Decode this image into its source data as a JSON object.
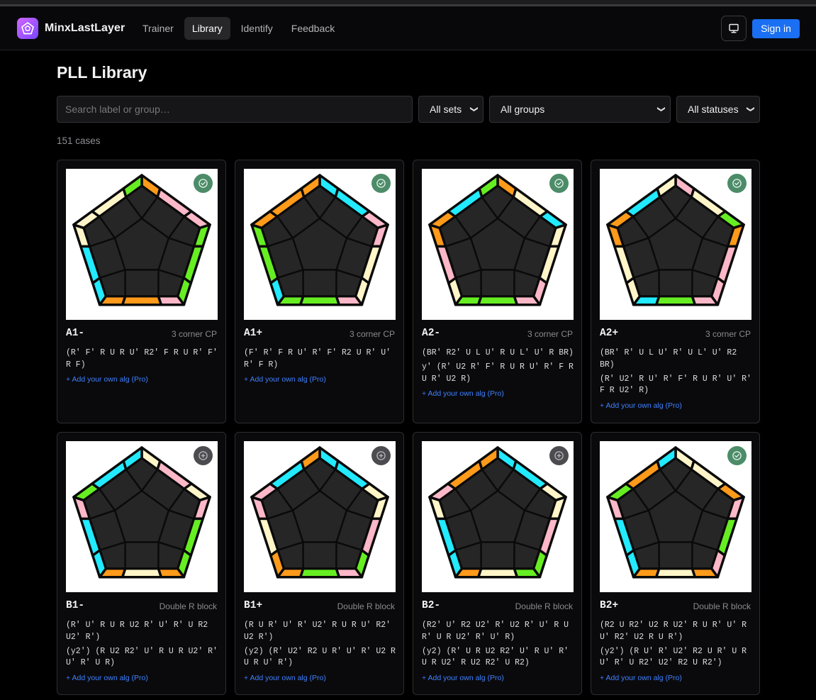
{
  "app": {
    "name": "MinxLastLayer",
    "signin_label": "Sign in"
  },
  "nav": [
    {
      "label": "Trainer",
      "active": false
    },
    {
      "label": "Library",
      "active": true
    },
    {
      "label": "Identify",
      "active": false
    },
    {
      "label": "Feedback",
      "active": false
    }
  ],
  "page": {
    "title": "PLL Library",
    "count_text": "151 cases"
  },
  "filters": {
    "search_placeholder": "Search label or group…",
    "sets": "All sets",
    "groups": "All groups",
    "statuses": "All statuses"
  },
  "add_alg_label": "+ Add your own alg (Pro)",
  "colors": {
    "orange": "#ff9a1a",
    "green": "#66ee22",
    "cream": "#fff5c8",
    "pink": "#fcb8c8",
    "cyan": "#22eaff",
    "face": "#262626",
    "brand": "#1a6ff2"
  },
  "cards": [
    {
      "label": "A1-",
      "group": "3 corner CP",
      "status": "learned",
      "algs": [
        "(R' F' R U R U' R2' F R U R' F' R F)"
      ],
      "edge_colors": [
        "orange",
        "pink",
        "pink",
        "green",
        "green",
        "green",
        "pink",
        "orange",
        "orange",
        "cyan",
        "cyan",
        "cream",
        "cream",
        "cream",
        "green"
      ]
    },
    {
      "label": "A1+",
      "group": "3 corner CP",
      "status": "learned",
      "algs": [
        "(F' R' F R U' R' F' R2 U R' U' R' F R)"
      ],
      "edge_colors": [
        "cyan",
        "cyan",
        "pink",
        "pink",
        "cream",
        "cream",
        "pink",
        "green",
        "green",
        "cyan",
        "green",
        "green",
        "orange",
        "orange",
        "orange"
      ]
    },
    {
      "label": "A2-",
      "group": "3 corner CP",
      "status": "learned",
      "algs": [
        "(BR' R2' U L U' R U L' U' R BR)",
        "y' (R' U2 R' F' R U R U' R' F R U R' U2 R)"
      ],
      "edge_colors": [
        "orange",
        "cream",
        "cyan",
        "cream",
        "cream",
        "pink",
        "pink",
        "green",
        "green",
        "cream",
        "pink",
        "orange",
        "orange",
        "cyan",
        "green"
      ]
    },
    {
      "label": "A2+",
      "group": "3 corner CP",
      "status": "learned",
      "algs": [
        "(BR' R' U L U' R' U L' U' R2 BR)",
        "(R' U2' R U' R' F' R U R' U' R' F R U2' R)"
      ],
      "edge_colors": [
        "pink",
        "cream",
        "green",
        "orange",
        "pink",
        "pink",
        "pink",
        "green",
        "cyan",
        "cream",
        "cream",
        "orange",
        "orange",
        "cyan",
        "cream"
      ]
    },
    {
      "label": "B1-",
      "group": "Double R block",
      "status": "unlearned",
      "algs": [
        "(R' U' R U R U2 R' U' R' U R2 U2' R')",
        "(y2') (R U2 R2' U' R U R U2' R' U' R' U R)"
      ],
      "edge_colors": [
        "cream",
        "pink",
        "cream",
        "pink",
        "green",
        "green",
        "orange",
        "cream",
        "orange",
        "cyan",
        "cyan",
        "pink",
        "green",
        "cyan",
        "cyan"
      ]
    },
    {
      "label": "B1+",
      "group": "Double R block",
      "status": "unlearned",
      "algs": [
        "(R U R' U' R' U2' R U R U' R2' U2 R')",
        "(y2) (R' U2' R2 U R' U' R' U2 R U R U' R')"
      ],
      "edge_colors": [
        "cyan",
        "cyan",
        "cream",
        "cream",
        "pink",
        "green",
        "pink",
        "green",
        "orange",
        "orange",
        "cream",
        "pink",
        "pink",
        "cyan",
        "orange"
      ]
    },
    {
      "label": "B2-",
      "group": "Double R block",
      "status": "unlearned",
      "algs": [
        "(R2' U' R2 U2' R' U2 R' U' R U R' U R U2' R' U' R)",
        "(y2) (R' U R U2 R2' U' R U' R' U R U2' R U2 R2' U R2)"
      ],
      "edge_colors": [
        "cyan",
        "cyan",
        "cream",
        "cream",
        "pink",
        "green",
        "green",
        "cream",
        "orange",
        "cyan",
        "cyan",
        "cream",
        "pink",
        "orange",
        "orange"
      ]
    },
    {
      "label": "B2+",
      "group": "Double R block",
      "status": "learned",
      "algs": [
        "(R2 U R2' U2 R U2' R U R' U' R U' R2' U2 R U R')",
        "(y2') (R U' R' U2' R2 U R' U R U' R' U R2' U2' R2 U R2')"
      ],
      "edge_colors": [
        "cream",
        "cream",
        "orange",
        "pink",
        "green",
        "pink",
        "orange",
        "cream",
        "orange",
        "cyan",
        "cyan",
        "pink",
        "green",
        "orange",
        "cyan"
      ]
    }
  ]
}
